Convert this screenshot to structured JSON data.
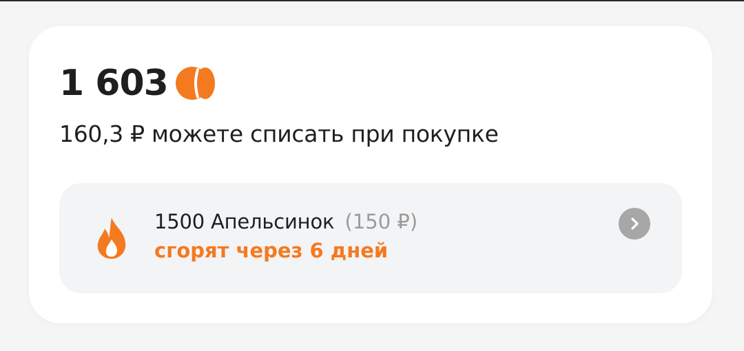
{
  "balance": {
    "value": "1 603",
    "currency_icon": "orange-coin-icon"
  },
  "subtitle": "160,3 ₽ можете списать при покупке",
  "expiring": {
    "amount_label": "1500 Апельсинок",
    "rub_value": "(150 ₽)",
    "deadline": "сгорят через 6 дней",
    "icon": "fire-icon",
    "action_icon": "chevron-right-icon"
  },
  "colors": {
    "accent": "#f47a20",
    "text": "#1f1f1f",
    "muted": "#9a9a9a",
    "card_bg": "#ffffff",
    "block_bg": "#f3f4f6",
    "chevron_bg": "#a7a7a7"
  }
}
